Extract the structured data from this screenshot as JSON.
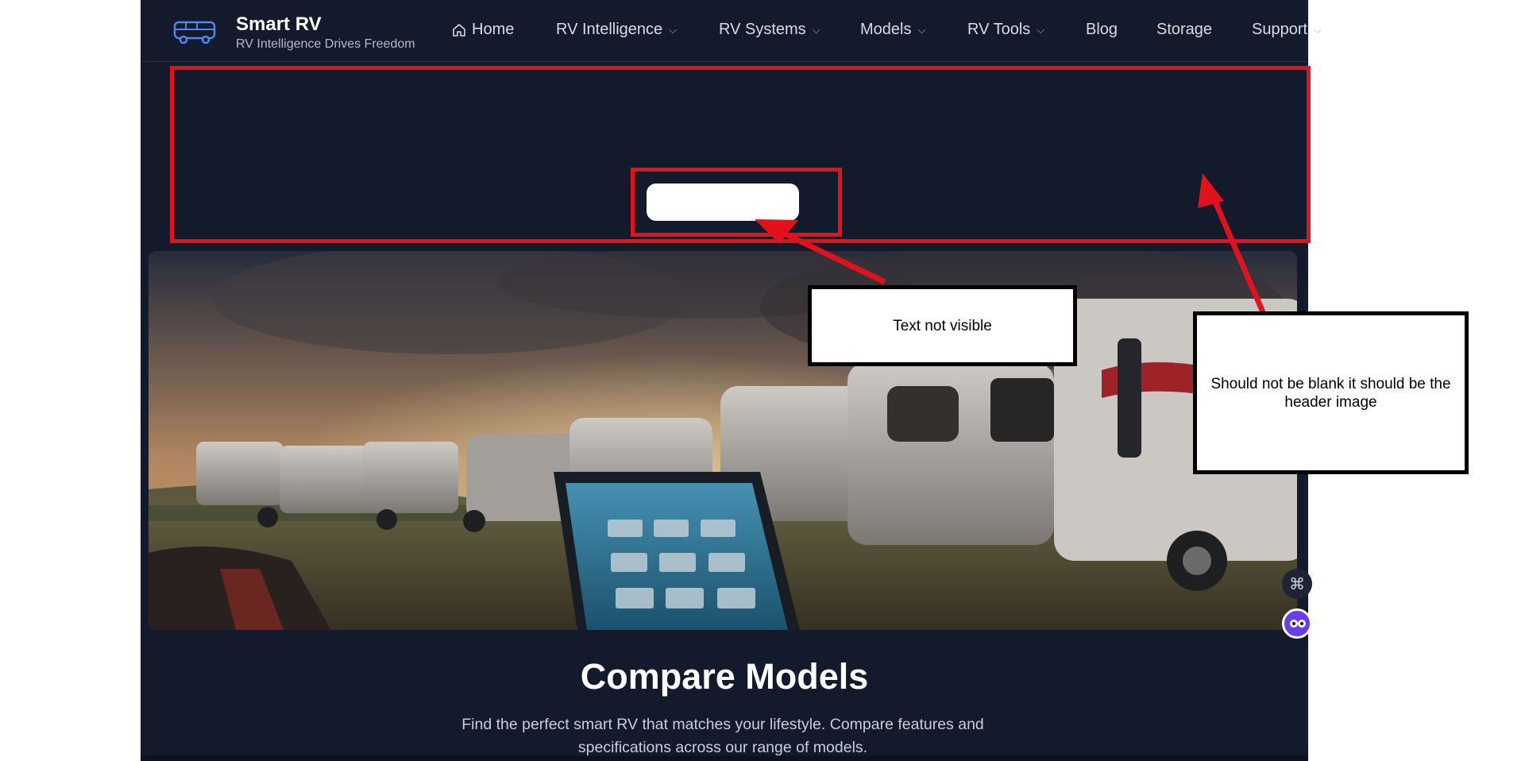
{
  "brand": {
    "name": "Smart RV",
    "tagline": "RV Intelligence Drives Freedom",
    "logo_icon": "rv-bus-icon"
  },
  "nav": {
    "home": "Home",
    "items": [
      {
        "label": "RV Intelligence",
        "has_dropdown": true
      },
      {
        "label": "RV Systems",
        "has_dropdown": true
      },
      {
        "label": "Models",
        "has_dropdown": true
      },
      {
        "label": "RV Tools",
        "has_dropdown": true
      },
      {
        "label": "Blog",
        "has_dropdown": false
      },
      {
        "label": "Storage",
        "has_dropdown": false
      },
      {
        "label": "Support",
        "has_dropdown": true
      }
    ]
  },
  "hero": {
    "button_label": "",
    "image_alt_visual": "row of RVs parked at sunset with a tablet in the foreground"
  },
  "section": {
    "title": "Compare Models",
    "subtitle": "Find the perfect smart RV that matches your lifestyle. Compare features and specifications across our range of models."
  },
  "annotations": {
    "text_not_visible": "Text not visible",
    "header_image_note": "Should not be blank it should be the header image"
  },
  "colors": {
    "site_background": "#131a2b",
    "annotation_red": "#e1121b",
    "accent_blue": "#4f86f0"
  },
  "floating_widgets": {
    "grid_icon": "apps-grid-icon",
    "chat_icon": "chat-assistant-icon"
  }
}
